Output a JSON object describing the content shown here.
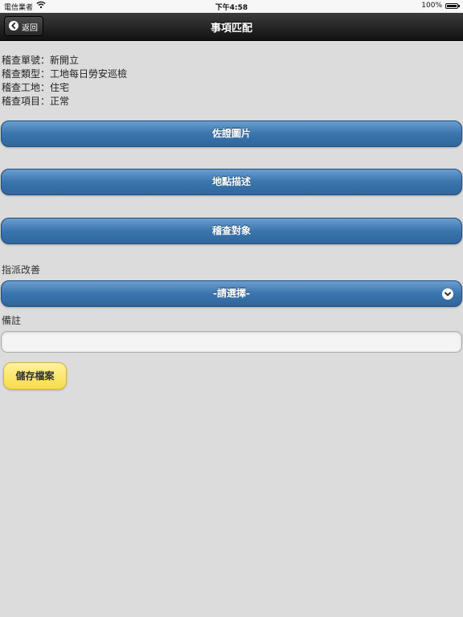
{
  "status_bar": {
    "carrier": "電信業者",
    "time": "下午4:58",
    "battery": "100%"
  },
  "header": {
    "title": "事項匹配",
    "back_label": "返回"
  },
  "info": {
    "inspection_number": "稽查單號：新開立",
    "inspection_type": "稽查類型：工地每日勞安巡檢",
    "inspection_site": "稽查工地：住宅",
    "inspection_item": "稽查項目：正常"
  },
  "buttons": {
    "evidence_photo": "佐證圖片",
    "location_description": "地點描述",
    "inspection_target": "稽查對象"
  },
  "assign": {
    "label": "指派改善",
    "selected": "-請選擇-"
  },
  "notes": {
    "label": "備註",
    "value": ""
  },
  "save_label": "儲存檔案"
}
